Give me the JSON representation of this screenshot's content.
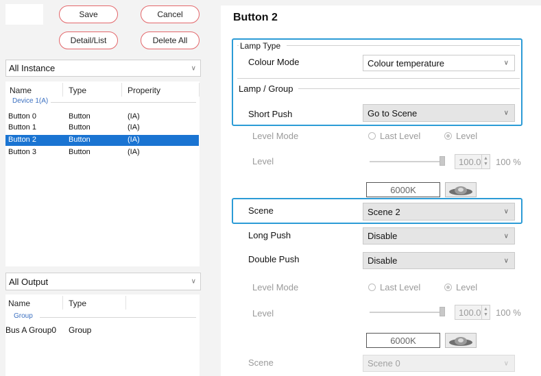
{
  "toolbar": {
    "save": "Save",
    "cancel": "Cancel",
    "detail_list": "Detail/List",
    "delete_all": "Delete All"
  },
  "instance_filter": {
    "value": "All Instance"
  },
  "instance_table": {
    "headers": [
      "Name",
      "Type",
      "Properity"
    ],
    "group": "Device 1(A)",
    "rows": [
      {
        "name": "Button 0",
        "type": "Button",
        "prop": "(IA)"
      },
      {
        "name": "Button 1",
        "type": "Button",
        "prop": "(IA)"
      },
      {
        "name": "Button 2",
        "type": "Button",
        "prop": "(IA)",
        "selected": true
      },
      {
        "name": "Button 3",
        "type": "Button",
        "prop": "(IA)"
      }
    ]
  },
  "output_filter": {
    "value": "All Output"
  },
  "output_table": {
    "headers": [
      "Name",
      "Type"
    ],
    "group": "Group",
    "rows": [
      {
        "name": "Bus A Group0",
        "type": "Group"
      }
    ]
  },
  "detail": {
    "title": "Button 2",
    "lamp_type_legend": "Lamp Type",
    "colour_mode_label": "Colour Mode",
    "colour_mode_value": "Colour temperature",
    "lamp_group_legend": "Lamp / Group",
    "short_push_label": "Short Push",
    "short_push_value": "Go to Scene",
    "level_mode_label": "Level Mode",
    "last_level": "Last Level",
    "level_option": "Level",
    "level_label": "Level",
    "level_value": "100.0",
    "level_pct": "100 %",
    "colour_temp": "6000K",
    "scene_label": "Scene",
    "scene_value": "Scene 2",
    "long_push_label": "Long Push",
    "long_push_value": "Disable",
    "double_push_label": "Double Push",
    "double_push_value": "Disable",
    "level_mode2_label": "Level Mode",
    "last_level2": "Last Level",
    "level_option2": "Level",
    "level2_label": "Level",
    "level2_value": "100.0",
    "level2_pct": "100 %",
    "colour_temp2": "6000K",
    "scene2_label": "Scene",
    "scene2_value": "Scene 0"
  },
  "colors": {
    "highlight": "#2b9bd6",
    "selection": "#1a74d2",
    "pill_border": "#e3666a"
  }
}
